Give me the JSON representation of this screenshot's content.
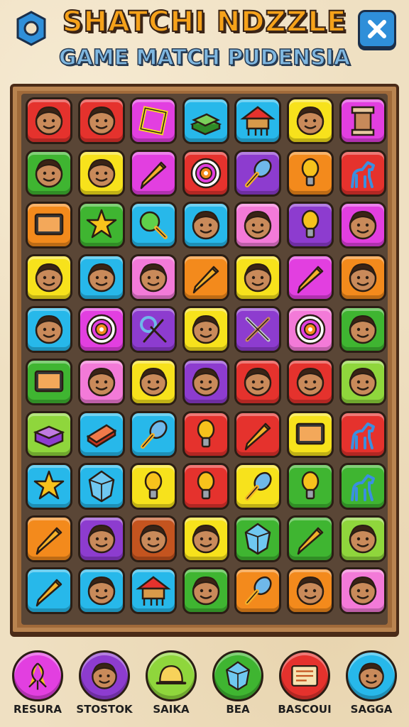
{
  "header": {
    "title": "SHATCHI NDZZLE",
    "subtitle": "GAME MATCH PUDENSIA"
  },
  "colors": {
    "red": "#e5322d",
    "green": "#3fb531",
    "magenta": "#e23fe0",
    "cyan": "#27b8ea",
    "yellow": "#f7e21c",
    "orange": "#f38a1c",
    "purple": "#8d3ccf",
    "pink": "#f37ad8",
    "lime": "#8fd63c",
    "blue": "#2e86d9",
    "brown": "#c4541f"
  },
  "board": {
    "rows": [
      [
        {
          "color": "red",
          "icon": "face-icon"
        },
        {
          "color": "red",
          "icon": "face-icon"
        },
        {
          "color": "magenta",
          "icon": "frame-icon"
        },
        {
          "color": "cyan",
          "icon": "book-icon"
        },
        {
          "color": "cyan",
          "icon": "hut-icon"
        },
        {
          "color": "yellow",
          "icon": "face-icon"
        },
        {
          "color": "magenta",
          "icon": "pillar-icon"
        }
      ],
      [
        {
          "color": "green",
          "icon": "face-icon"
        },
        {
          "color": "yellow",
          "icon": "face-icon"
        },
        {
          "color": "magenta",
          "icon": "pencil-icon"
        },
        {
          "color": "red",
          "icon": "target-icon"
        },
        {
          "color": "purple",
          "icon": "mallet-icon"
        },
        {
          "color": "orange",
          "icon": "bulb-icon"
        },
        {
          "color": "red",
          "icon": "horse-icon"
        }
      ],
      [
        {
          "color": "orange",
          "icon": "tablet-icon"
        },
        {
          "color": "green",
          "icon": "star-badge-icon"
        },
        {
          "color": "cyan",
          "icon": "racket-icon"
        },
        {
          "color": "cyan",
          "icon": "face-icon"
        },
        {
          "color": "pink",
          "icon": "face-icon"
        },
        {
          "color": "purple",
          "icon": "bulb-icon"
        },
        {
          "color": "magenta",
          "icon": "face-icon"
        }
      ],
      [
        {
          "color": "yellow",
          "icon": "face-icon"
        },
        {
          "color": "cyan",
          "icon": "face-icon"
        },
        {
          "color": "pink",
          "icon": "face-icon"
        },
        {
          "color": "orange",
          "icon": "pencil-icon"
        },
        {
          "color": "yellow",
          "icon": "face-icon"
        },
        {
          "color": "magenta",
          "icon": "pencil-icon"
        },
        {
          "color": "orange",
          "icon": "face-icon"
        }
      ],
      [
        {
          "color": "cyan",
          "icon": "face-icon"
        },
        {
          "color": "magenta",
          "icon": "target-icon"
        },
        {
          "color": "purple",
          "icon": "tools-icon"
        },
        {
          "color": "yellow",
          "icon": "face-icon"
        },
        {
          "color": "purple",
          "icon": "crossed-tools-icon"
        },
        {
          "color": "pink",
          "icon": "target-icon"
        },
        {
          "color": "green",
          "icon": "face-icon"
        }
      ],
      [
        {
          "color": "green",
          "icon": "tablet-icon"
        },
        {
          "color": "pink",
          "icon": "face-icon"
        },
        {
          "color": "yellow",
          "icon": "face-icon"
        },
        {
          "color": "purple",
          "icon": "face-icon"
        },
        {
          "color": "red",
          "icon": "face-icon"
        },
        {
          "color": "red",
          "icon": "face-icon"
        },
        {
          "color": "lime",
          "icon": "face-icon"
        }
      ],
      [
        {
          "color": "lime",
          "icon": "box-icon"
        },
        {
          "color": "cyan",
          "icon": "brick-icon"
        },
        {
          "color": "cyan",
          "icon": "mallet-icon"
        },
        {
          "color": "red",
          "icon": "bulb-icon"
        },
        {
          "color": "red",
          "icon": "pencil-icon"
        },
        {
          "color": "yellow",
          "icon": "tablet-icon"
        },
        {
          "color": "red",
          "icon": "horse-icon"
        }
      ],
      [
        {
          "color": "cyan",
          "icon": "star-icon"
        },
        {
          "color": "cyan",
          "icon": "gem-icon"
        },
        {
          "color": "yellow",
          "icon": "bulb-icon"
        },
        {
          "color": "red",
          "icon": "bulb-icon"
        },
        {
          "color": "yellow",
          "icon": "mallet-icon"
        },
        {
          "color": "green",
          "icon": "bulb-icon"
        },
        {
          "color": "green",
          "icon": "horse-icon"
        }
      ],
      [
        {
          "color": "orange",
          "icon": "pencil-icon"
        },
        {
          "color": "purple",
          "icon": "face-icon"
        },
        {
          "color": "brown",
          "icon": "face-icon"
        },
        {
          "color": "yellow",
          "icon": "face-icon"
        },
        {
          "color": "green",
          "icon": "gem-icon"
        },
        {
          "color": "green",
          "icon": "pencil-icon"
        },
        {
          "color": "lime",
          "icon": "face-icon"
        }
      ],
      [
        {
          "color": "cyan",
          "icon": "pencil-icon"
        },
        {
          "color": "cyan",
          "icon": "face-icon"
        },
        {
          "color": "cyan",
          "icon": "hut-icon"
        },
        {
          "color": "green",
          "icon": "face-icon"
        },
        {
          "color": "orange",
          "icon": "mallet-icon"
        },
        {
          "color": "orange",
          "icon": "face-icon"
        },
        {
          "color": "pink",
          "icon": "face-icon"
        }
      ]
    ]
  },
  "bottom_bar": [
    {
      "label": "RESURA",
      "color": "magenta",
      "icon": "leaf-icon"
    },
    {
      "label": "STOSTOK",
      "color": "purple",
      "icon": "face-icon"
    },
    {
      "label": "SAIKA",
      "color": "lime",
      "icon": "hat-icon"
    },
    {
      "label": "BEA",
      "color": "green",
      "icon": "gem-icon"
    },
    {
      "label": "BASCOUI",
      "color": "red",
      "icon": "card-icon"
    },
    {
      "label": "SAGGA",
      "color": "cyan",
      "icon": "face-icon"
    }
  ]
}
